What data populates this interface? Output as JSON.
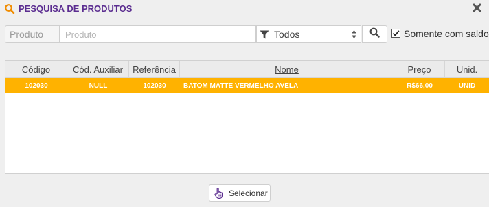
{
  "window": {
    "title": "PESQUISA DE PRODUTOS",
    "accent_color": "#5b2d90",
    "icon_color": "#f08c00"
  },
  "search": {
    "label": "Produto",
    "placeholder": "Produto",
    "value": "",
    "filter_selected": "Todos",
    "only_with_stock_label": "Somente com saldo",
    "only_with_stock_checked": true
  },
  "grid": {
    "columns": [
      "Código",
      "Cód. Auxiliar",
      "Referência",
      "Nome",
      "Preço",
      "Unid."
    ],
    "sorted_column": "Nome",
    "rows": [
      {
        "codigo": "102030",
        "cod_auxiliar": "NULL",
        "referencia": "102030",
        "nome": "BATOM MATTE VERMELHO AVELA",
        "preco": "R$66,00",
        "unid": "UNID",
        "selected": true
      }
    ],
    "selected_row_color": "#ffb200"
  },
  "footer": {
    "select_label": "Selecionar"
  },
  "icons": {
    "title": "search-icon",
    "close": "close-icon",
    "filter": "filter-icon",
    "sort": "sort-icon",
    "search_button": "search-icon",
    "select": "hand-pointer-icon"
  }
}
